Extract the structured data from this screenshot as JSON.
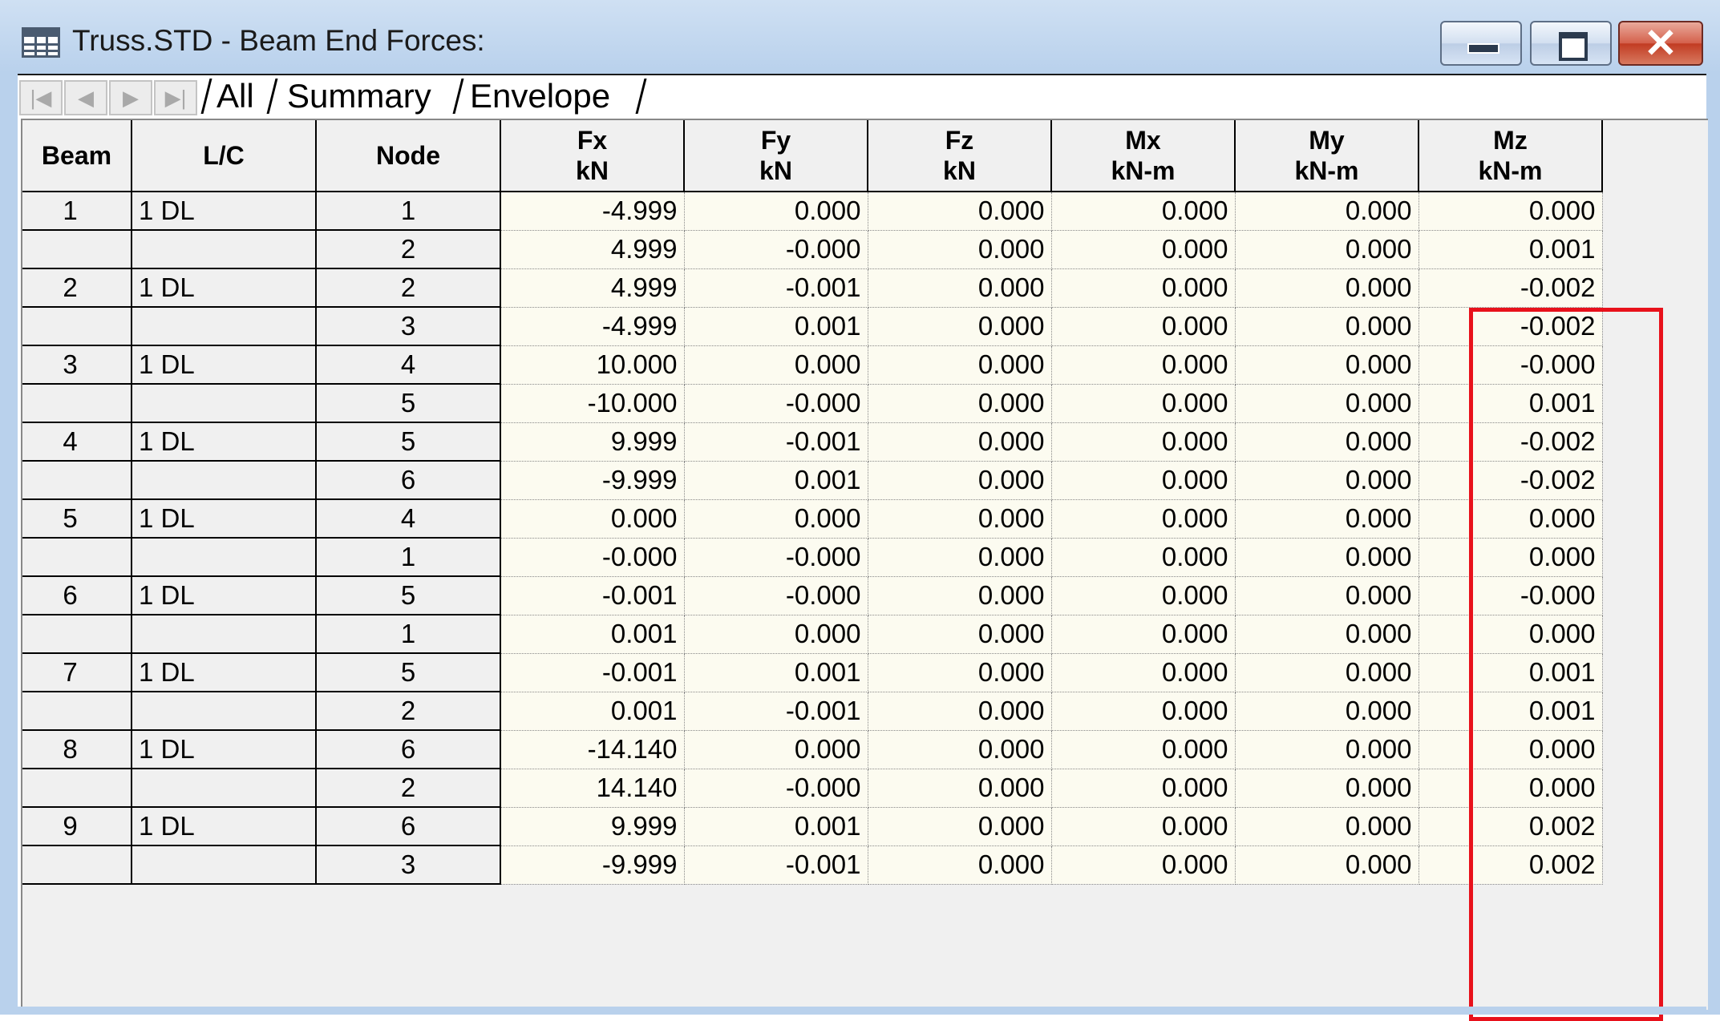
{
  "window": {
    "title": "Truss.STD - Beam End Forces:",
    "icon": "table-icon",
    "controls": {
      "minimize": "minimize-icon",
      "maximize": "maximize-icon",
      "close": "close-icon"
    }
  },
  "tabs": {
    "nav": [
      "first-icon",
      "previous-icon",
      "next-icon",
      "last-icon"
    ],
    "items": [
      {
        "label": "All",
        "active": true
      },
      {
        "label": "Summary",
        "active": false
      },
      {
        "label": "Envelope",
        "active": false
      }
    ]
  },
  "table": {
    "headers": {
      "beam": "Beam",
      "lc": "L/C",
      "node": "Node",
      "fx": {
        "name": "Fx",
        "unit": "kN"
      },
      "fy": {
        "name": "Fy",
        "unit": "kN"
      },
      "fz": {
        "name": "Fz",
        "unit": "kN"
      },
      "mx": {
        "name": "Mx",
        "unit": "kN-m"
      },
      "my": {
        "name": "My",
        "unit": "kN-m"
      },
      "mz": {
        "name": "Mz",
        "unit": "kN-m"
      }
    },
    "rows": [
      {
        "beam": "1",
        "lc": "1 DL",
        "node": "1",
        "fx": "-4.999",
        "fy": "0.000",
        "fz": "0.000",
        "mx": "0.000",
        "my": "0.000",
        "mz": "0.000"
      },
      {
        "beam": "",
        "lc": "",
        "node": "2",
        "fx": "4.999",
        "fy": "-0.000",
        "fz": "0.000",
        "mx": "0.000",
        "my": "0.000",
        "mz": "0.001"
      },
      {
        "beam": "2",
        "lc": "1 DL",
        "node": "2",
        "fx": "4.999",
        "fy": "-0.001",
        "fz": "0.000",
        "mx": "0.000",
        "my": "0.000",
        "mz": "-0.002"
      },
      {
        "beam": "",
        "lc": "",
        "node": "3",
        "fx": "-4.999",
        "fy": "0.001",
        "fz": "0.000",
        "mx": "0.000",
        "my": "0.000",
        "mz": "-0.002"
      },
      {
        "beam": "3",
        "lc": "1 DL",
        "node": "4",
        "fx": "10.000",
        "fy": "0.000",
        "fz": "0.000",
        "mx": "0.000",
        "my": "0.000",
        "mz": "-0.000"
      },
      {
        "beam": "",
        "lc": "",
        "node": "5",
        "fx": "-10.000",
        "fy": "-0.000",
        "fz": "0.000",
        "mx": "0.000",
        "my": "0.000",
        "mz": "0.001"
      },
      {
        "beam": "4",
        "lc": "1 DL",
        "node": "5",
        "fx": "9.999",
        "fy": "-0.001",
        "fz": "0.000",
        "mx": "0.000",
        "my": "0.000",
        "mz": "-0.002"
      },
      {
        "beam": "",
        "lc": "",
        "node": "6",
        "fx": "-9.999",
        "fy": "0.001",
        "fz": "0.000",
        "mx": "0.000",
        "my": "0.000",
        "mz": "-0.002"
      },
      {
        "beam": "5",
        "lc": "1 DL",
        "node": "4",
        "fx": "0.000",
        "fy": "0.000",
        "fz": "0.000",
        "mx": "0.000",
        "my": "0.000",
        "mz": "0.000"
      },
      {
        "beam": "",
        "lc": "",
        "node": "1",
        "fx": "-0.000",
        "fy": "-0.000",
        "fz": "0.000",
        "mx": "0.000",
        "my": "0.000",
        "mz": "0.000"
      },
      {
        "beam": "6",
        "lc": "1 DL",
        "node": "5",
        "fx": "-0.001",
        "fy": "-0.000",
        "fz": "0.000",
        "mx": "0.000",
        "my": "0.000",
        "mz": "-0.000"
      },
      {
        "beam": "",
        "lc": "",
        "node": "1",
        "fx": "0.001",
        "fy": "0.000",
        "fz": "0.000",
        "mx": "0.000",
        "my": "0.000",
        "mz": "0.000"
      },
      {
        "beam": "7",
        "lc": "1 DL",
        "node": "5",
        "fx": "-0.001",
        "fy": "0.001",
        "fz": "0.000",
        "mx": "0.000",
        "my": "0.000",
        "mz": "0.001"
      },
      {
        "beam": "",
        "lc": "",
        "node": "2",
        "fx": "0.001",
        "fy": "-0.001",
        "fz": "0.000",
        "mx": "0.000",
        "my": "0.000",
        "mz": "0.001"
      },
      {
        "beam": "8",
        "lc": "1 DL",
        "node": "6",
        "fx": "-14.140",
        "fy": "0.000",
        "fz": "0.000",
        "mx": "0.000",
        "my": "0.000",
        "mz": "0.000"
      },
      {
        "beam": "",
        "lc": "",
        "node": "2",
        "fx": "14.140",
        "fy": "-0.000",
        "fz": "0.000",
        "mx": "0.000",
        "my": "0.000",
        "mz": "0.000"
      },
      {
        "beam": "9",
        "lc": "1 DL",
        "node": "6",
        "fx": "9.999",
        "fy": "0.001",
        "fz": "0.000",
        "mx": "0.000",
        "my": "0.000",
        "mz": "0.002"
      },
      {
        "beam": "",
        "lc": "",
        "node": "3",
        "fx": "-9.999",
        "fy": "-0.001",
        "fz": "0.000",
        "mx": "0.000",
        "my": "0.000",
        "mz": "0.002"
      }
    ]
  },
  "highlight": {
    "column": "mz",
    "color": "#e8111b"
  }
}
